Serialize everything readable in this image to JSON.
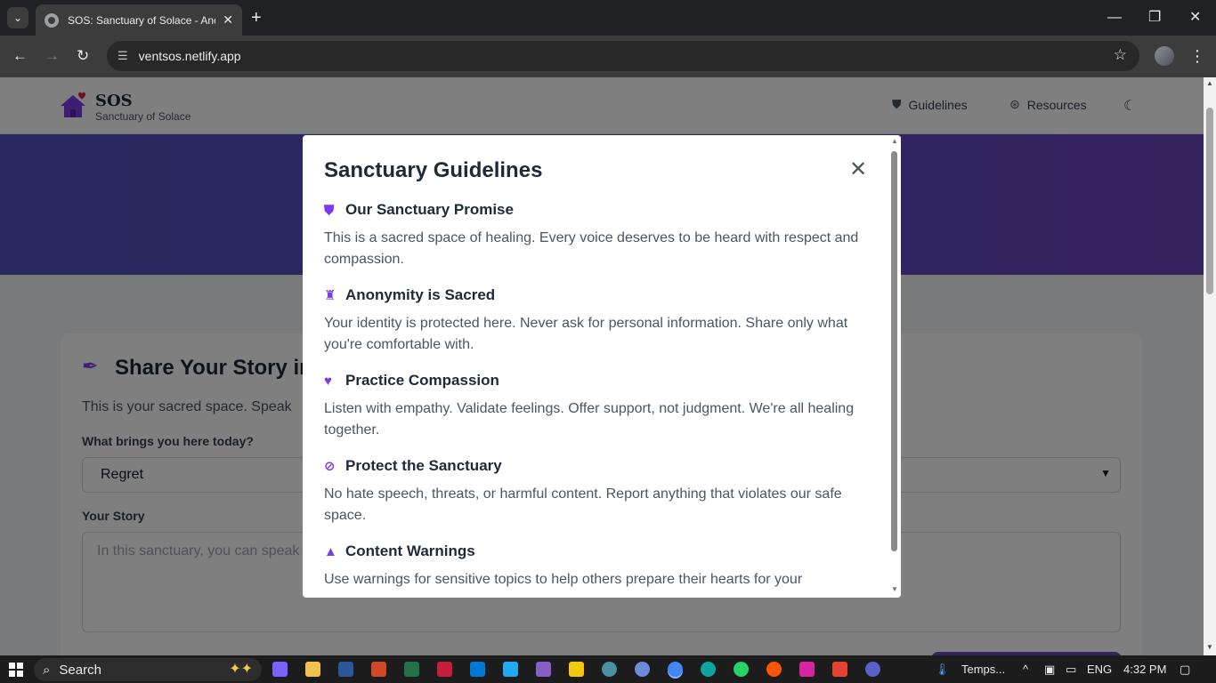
{
  "browser": {
    "tab_title": "SOS: Sanctuary of Solace - Anonymous Venting",
    "tab_close": "✕",
    "new_tab": "+",
    "url": "ventsos.netlify.app"
  },
  "site": {
    "brand": "SOS",
    "tagline": "Sanctuary of Solace",
    "nav": [
      {
        "label": "Guidelines",
        "icon": "shield-icon"
      },
      {
        "label": "Resources",
        "icon": "lifering-icon"
      }
    ],
    "theme_toggle_icon": "moon-icon"
  },
  "form": {
    "title": "Share Your Story in",
    "intro": "This is your sacred space. Speak",
    "topic_label": "What brings you here today?",
    "topic_value": "Regret",
    "story_label": "Your Story",
    "story_placeholder": "In this sanctuary, you can speak"
  },
  "modal": {
    "title": "Sanctuary Guidelines",
    "close": "✕",
    "guidelines": [
      {
        "icon": "shield-icon",
        "title": "Our Sanctuary Promise",
        "text": "This is a sacred space of healing. Every voice deserves to be heard with respect and compassion."
      },
      {
        "icon": "user-secret-icon",
        "title": "Anonymity is Sacred",
        "text": "Your identity is protected here. Never ask for personal information. Share only what you're comfortable with."
      },
      {
        "icon": "heart-icon",
        "title": "Practice Compassion",
        "text": "Listen with empathy. Validate feelings. Offer support, not judgment. We're all healing together."
      },
      {
        "icon": "ban-icon",
        "title": "Protect the Sanctuary",
        "text": "No hate speech, threats, or harmful content. Report anything that violates our safe space."
      },
      {
        "icon": "warning-icon",
        "title": "Content Warnings",
        "text": "Use warnings for sensitive topics to help others prepare their hearts for your"
      }
    ]
  },
  "taskbar": {
    "search": "Search",
    "weather": "Temps...",
    "lang": "ENG",
    "time": "4:32 PM"
  },
  "colors": {
    "accent": "#7c3aed",
    "hero_start": "#4c51bf",
    "hero_end": "#6b46c1"
  }
}
